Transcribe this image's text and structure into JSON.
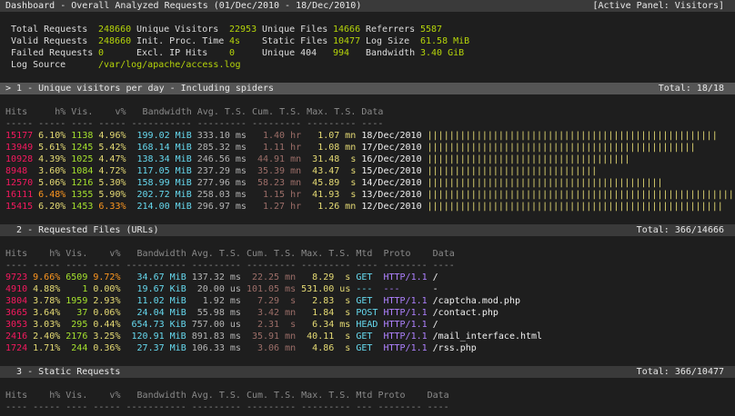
{
  "title": "Dashboard - Overall Analyzed Requests (01/Dec/2010 - 18/Dec/2010)",
  "active_panel": "[Active Panel: Visitors]",
  "summary": [
    [
      {
        "label": "Total Requests",
        "value": "248660"
      },
      {
        "label": "Unique Visitors",
        "value": "22953"
      },
      {
        "label": "Unique Files",
        "value": "14666"
      },
      {
        "label": "Referrers",
        "value": "5587"
      }
    ],
    [
      {
        "label": "Valid Requests",
        "value": "248660"
      },
      {
        "label": "Init. Proc. Time",
        "value": "4s"
      },
      {
        "label": "Static Files",
        "value": "10477"
      },
      {
        "label": "Log Size",
        "value": "61.58 MiB"
      }
    ],
    [
      {
        "label": "Failed Requests",
        "value": "0"
      },
      {
        "label": "Excl. IP Hits",
        "value": "0"
      },
      {
        "label": "Unique 404",
        "value": "994"
      },
      {
        "label": "Bandwidth",
        "value": "3.40 GiB"
      }
    ]
  ],
  "log_source": {
    "label": "Log Source",
    "value": "/var/log/apache/access.log"
  },
  "panels": [
    {
      "title": "> 1 - Unique visitors per day - Including spiders",
      "total": "Total: 18/18",
      "active": true,
      "headers": [
        "Hits",
        "h%",
        "Vis.",
        "v%",
        "Bandwidth",
        "Avg. T.S.",
        "Cum. T.S.",
        "Max. T.S.",
        "Data"
      ],
      "dashes": [
        "-----",
        "-----",
        "----",
        "-----",
        "-----------",
        "---------",
        "---------",
        "---------",
        "----"
      ],
      "rows": [
        {
          "hits": "15177",
          "hp": "6.10%",
          "vis": "1138",
          "vp": "4.96%",
          "bw": "199.02 MiB",
          "avg": "333.10 ms",
          "cum": "1.40 hr",
          "max": "1.07 mn",
          "data": "18/Dec/2010",
          "bar": 53
        },
        {
          "hits": "13949",
          "hp": "5.61%",
          "vis": "1245",
          "vp": "5.42%",
          "bw": "168.14 MiB",
          "avg": "285.32 ms",
          "cum": "1.11 hr",
          "max": "1.08 mn",
          "data": "17/Dec/2010",
          "bar": 49
        },
        {
          "hits": "10928",
          "hp": "4.39%",
          "vis": "1025",
          "vp": "4.47%",
          "bw": "138.34 MiB",
          "avg": "246.56 ms",
          "cum": "44.91 mn",
          "max": "31.48  s",
          "data": "16/Dec/2010",
          "bar": 37
        },
        {
          "hits": "8948",
          "hp": "3.60%",
          "vis": "1084",
          "vp": "4.72%",
          "bw": "117.05 MiB",
          "avg": "237.29 ms",
          "cum": "35.39 mn",
          "max": "43.47  s",
          "data": "15/Dec/2010",
          "bar": 31
        },
        {
          "hits": "12570",
          "hp": "5.06%",
          "vis": "1216",
          "vp": "5.30%",
          "bw": "158.99 MiB",
          "avg": "277.96 ms",
          "cum": "58.23 mn",
          "max": "45.89  s",
          "data": "14/Dec/2010",
          "bar": 43
        },
        {
          "hits": "16111",
          "hp": "6.48%",
          "vis": "1355",
          "vp": "5.90%",
          "bw": "202.72 MiB",
          "avg": "258.03 ms",
          "cum": "1.15 hr",
          "max": "41.93  s",
          "data": "13/Dec/2010",
          "bar": 56,
          "hp_hi": true
        },
        {
          "hits": "15415",
          "hp": "6.20%",
          "vis": "1453",
          "vp": "6.33%",
          "bw": "214.00 MiB",
          "avg": "296.97 ms",
          "cum": "1.27 hr",
          "max": "1.26 mn",
          "data": "12/Dec/2010",
          "bar": 54,
          "vp_hi": true
        }
      ]
    },
    {
      "title": "  2 - Requested Files (URLs)",
      "total": "Total: 366/14666",
      "active": false,
      "headers": [
        "Hits",
        "h%",
        "Vis.",
        "v%",
        "Bandwidth",
        "Avg. T.S.",
        "Cum. T.S.",
        "Max. T.S.",
        "Mtd",
        "Proto",
        "Data"
      ],
      "dashes": [
        "----",
        "-----",
        "----",
        "-----",
        "-----------",
        "---------",
        "---------",
        "---------",
        "----",
        "--------",
        "----"
      ],
      "rows": [
        {
          "hits": "9723",
          "hp": "9.66%",
          "vis": "6509",
          "vp": "9.72%",
          "bw": "34.67 MiB",
          "avg": "137.32 ms",
          "cum": "22.25 mn",
          "max": "8.29  s",
          "mtd": "GET",
          "proto": "HTTP/1.1",
          "data": "/",
          "hp_hi": true,
          "vp_hi": true
        },
        {
          "hits": "4910",
          "hp": "4.88%",
          "vis": "1",
          "vp": "0.00%",
          "bw": "19.67 KiB",
          "avg": "20.00 us",
          "cum": "101.05 ms",
          "max": "531.00 us",
          "mtd": "---",
          "proto": "---",
          "data": "-"
        },
        {
          "hits": "3804",
          "hp": "3.78%",
          "vis": "1959",
          "vp": "2.93%",
          "bw": "11.02 MiB",
          "avg": "1.92 ms",
          "cum": "7.29  s",
          "max": "2.83  s",
          "mtd": "GET",
          "proto": "HTTP/1.1",
          "data": "/captcha.mod.php"
        },
        {
          "hits": "3665",
          "hp": "3.64%",
          "vis": "37",
          "vp": "0.06%",
          "bw": "24.04 MiB",
          "avg": "55.98 ms",
          "cum": "3.42 mn",
          "max": "1.84  s",
          "mtd": "POST",
          "proto": "HTTP/1.1",
          "data": "/contact.php"
        },
        {
          "hits": "3053",
          "hp": "3.03%",
          "vis": "295",
          "vp": "0.44%",
          "bw": "654.73 KiB",
          "avg": "757.00 us",
          "cum": "2.31  s",
          "max": "6.34 ms",
          "mtd": "HEAD",
          "proto": "HTTP/1.1",
          "data": "/"
        },
        {
          "hits": "2416",
          "hp": "2.40%",
          "vis": "2176",
          "vp": "3.25%",
          "bw": "120.91 MiB",
          "avg": "891.83 ms",
          "cum": "35.91 mn",
          "max": "40.11  s",
          "mtd": "GET",
          "proto": "HTTP/1.1",
          "data": "/mail_interface.html"
        },
        {
          "hits": "1724",
          "hp": "1.71%",
          "vis": "244",
          "vp": "0.36%",
          "bw": "27.37 MiB",
          "avg": "106.33 ms",
          "cum": "3.06 mn",
          "max": "4.86  s",
          "mtd": "GET",
          "proto": "HTTP/1.1",
          "data": "/rss.php"
        }
      ]
    },
    {
      "title": "  3 - Static Requests",
      "total": "Total: 366/10477",
      "active": false,
      "headers": [
        "Hits",
        "h%",
        "Vis.",
        "v%",
        "Bandwidth",
        "Avg. T.S.",
        "Cum. T.S.",
        "Max. T.S.",
        "Mtd",
        "Proto",
        "Data"
      ],
      "dashes": [
        "----",
        "-----",
        "----",
        "-----",
        "-----------",
        "---------",
        "---------",
        "---------",
        "---",
        "--------",
        "----"
      ],
      "rows": []
    }
  ]
}
